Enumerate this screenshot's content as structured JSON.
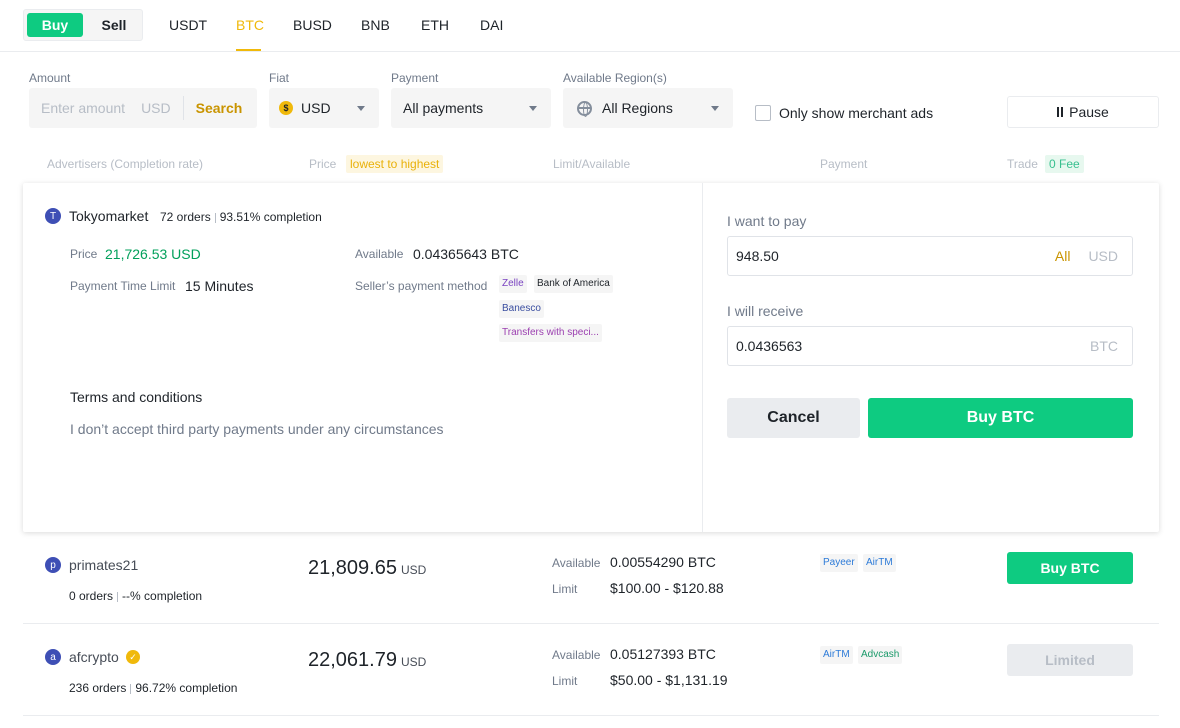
{
  "top": {
    "buy": "Buy",
    "sell": "Sell",
    "coins": [
      "USDT",
      "BTC",
      "BUSD",
      "BNB",
      "ETH",
      "DAI"
    ]
  },
  "filters": {
    "amount_label": "Amount",
    "amount_placeholder": "Enter amount",
    "amount_unit": "USD",
    "search": "Search",
    "fiat_label": "Fiat",
    "fiat_value": "USD",
    "fiat_icon": "$",
    "payment_label": "Payment",
    "payment_value": "All payments",
    "region_label": "Available Region(s)",
    "region_value": "All Regions",
    "merchant_only": "Only show merchant ads",
    "pause": "Pause"
  },
  "header": {
    "advertisers": "Advertisers (Completion rate)",
    "price": "Price",
    "price_sort": "lowest to highest",
    "limit": "Limit/Available",
    "payment": "Payment",
    "trade": "Trade",
    "fee": "0 Fee"
  },
  "expanded": {
    "avatar": "T",
    "name": "Tokyomarket",
    "orders": "72 orders",
    "completion": "93.51% completion",
    "price_label": "Price",
    "price_value": "21,726.53 USD",
    "available_label": "Available",
    "available_value": "0.04365643 BTC",
    "time_label": "Payment Time Limit",
    "time_value": "15 Minutes",
    "method_label": "Seller’s payment method",
    "methods": [
      "Zelle",
      "Bank of America",
      "Banesco",
      "Transfers with speci..."
    ],
    "method_colors": [
      "#7a43c1",
      "#1e2329",
      "#3a4ea0",
      "#9b3fb0"
    ],
    "terms_title": "Terms and conditions",
    "terms_text": "I don’t accept third party payments under any circumstances",
    "pay_label": "I want to pay",
    "pay_value": "948.50",
    "pay_all": "All",
    "pay_unit": "USD",
    "receive_label": "I will receive",
    "receive_value": "0.0436563",
    "receive_unit": "BTC",
    "cancel": "Cancel",
    "buy": "Buy BTC"
  },
  "rows": [
    {
      "avatar": "p",
      "name": "primates21",
      "orders": "0 orders",
      "completion": "--% completion",
      "price": "21,809.65",
      "unit": "USD",
      "available_label": "Available",
      "available": "0.00554290 BTC",
      "limit_label": "Limit",
      "limit": "$100.00 - $120.88",
      "methods": [
        "Payeer",
        "AirTM"
      ],
      "method_colors": [
        "#2d7bd8",
        "#2d7bd8"
      ],
      "action": "Buy BTC"
    },
    {
      "avatar": "a",
      "name": "afcrypto",
      "orders": "236 orders",
      "completion": "96.72% completion",
      "price": "22,061.79",
      "unit": "USD",
      "available_label": "Available",
      "available": "0.05127393 BTC",
      "limit_label": "Limit",
      "limit": "$50.00 - $1,131.19",
      "methods": [
        "AirTM",
        "Advcash"
      ],
      "method_colors": [
        "#2d7bd8",
        "#1a9a6a"
      ],
      "action": "Limited"
    }
  ]
}
